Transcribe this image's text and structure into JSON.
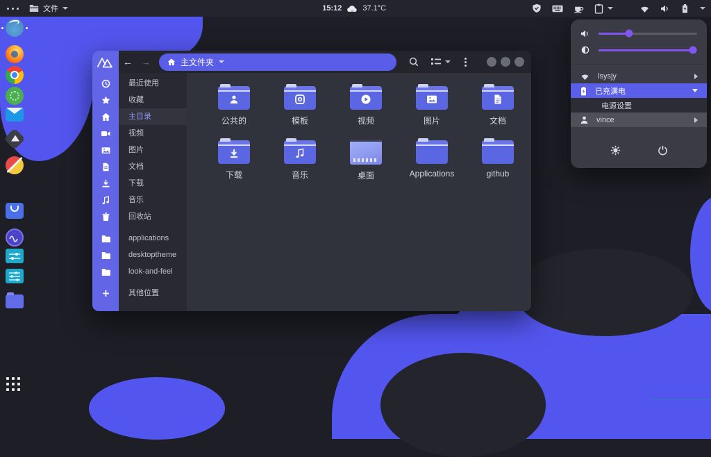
{
  "colors": {
    "accent_purple": "#5356ee",
    "panel_bg": "#23242d",
    "window_bg": "#30323c",
    "sidebar_strip": "#6165e6",
    "folder_blue": "#5b66e2",
    "highlight_row": "#5a5ee8",
    "slider_purple": "#8055f0",
    "tray_underline": "#4468d8"
  },
  "panel": {
    "workspace_indicator": "activities-dots",
    "app_menu": {
      "icon": "files-folder-icon",
      "label": "文件"
    },
    "clock": "15:12",
    "weather": {
      "icon": "cloud-icon",
      "temperature": "37.1°C"
    },
    "tray_icons": [
      "shield-check-icon",
      "keyboard-icon",
      "coffee-icon",
      "clipboard-icon",
      "wifi-icon",
      "volume-icon",
      "battery-icon"
    ]
  },
  "dock": {
    "items": [
      "web-planet",
      "firefox",
      "chrome",
      "green-app",
      "mail",
      "inkscape",
      "ball-game",
      "software-store",
      "system-monitor",
      "settings-sliders",
      "settings-sliders-2",
      "files-folder"
    ],
    "launcher": "show-applications-grid"
  },
  "window": {
    "pathbar": {
      "location": "主文件夹"
    },
    "sidebar": [
      {
        "label": "最近使用",
        "icon": "clock-icon"
      },
      {
        "label": "收藏",
        "icon": "star-icon"
      },
      {
        "label": "主目录",
        "icon": "home-icon",
        "selected": true
      },
      {
        "label": "视频",
        "icon": "video-icon"
      },
      {
        "label": "图片",
        "icon": "image-icon"
      },
      {
        "label": "文档",
        "icon": "document-icon"
      },
      {
        "label": "下载",
        "icon": "download-icon"
      },
      {
        "label": "音乐",
        "icon": "music-icon"
      },
      {
        "label": "回收站",
        "icon": "trash-icon"
      },
      {
        "label": "applications",
        "icon": "folder-icon"
      },
      {
        "label": "desktoptheme",
        "icon": "folder-icon"
      },
      {
        "label": "look-and-feel",
        "icon": "folder-icon"
      },
      {
        "label": "其他位置",
        "icon": "plus-icon"
      }
    ],
    "folders": [
      {
        "name": "公共的",
        "emblem": "person"
      },
      {
        "name": "模板",
        "emblem": "template"
      },
      {
        "name": "视频",
        "emblem": "play"
      },
      {
        "name": "图片",
        "emblem": "image"
      },
      {
        "name": "文档",
        "emblem": "document"
      },
      {
        "name": "下载",
        "emblem": "download"
      },
      {
        "name": "音乐",
        "emblem": "music"
      },
      {
        "name": "桌面",
        "emblem": "desktop-thumbnail"
      },
      {
        "name": "Applications",
        "emblem": null
      },
      {
        "name": "github",
        "emblem": null
      }
    ]
  },
  "popup": {
    "sliders": {
      "volume_percent": 31,
      "brightness_percent": 96
    },
    "network": {
      "icon": "wifi-icon",
      "label": "lsysjy"
    },
    "battery": {
      "icon": "battery-charging-icon",
      "label": "已充满电",
      "expanded": true
    },
    "battery_menu_item": "电源设置",
    "user": {
      "icon": "person-icon",
      "label": "vince"
    },
    "buttons": [
      "settings-gear",
      "power"
    ]
  }
}
